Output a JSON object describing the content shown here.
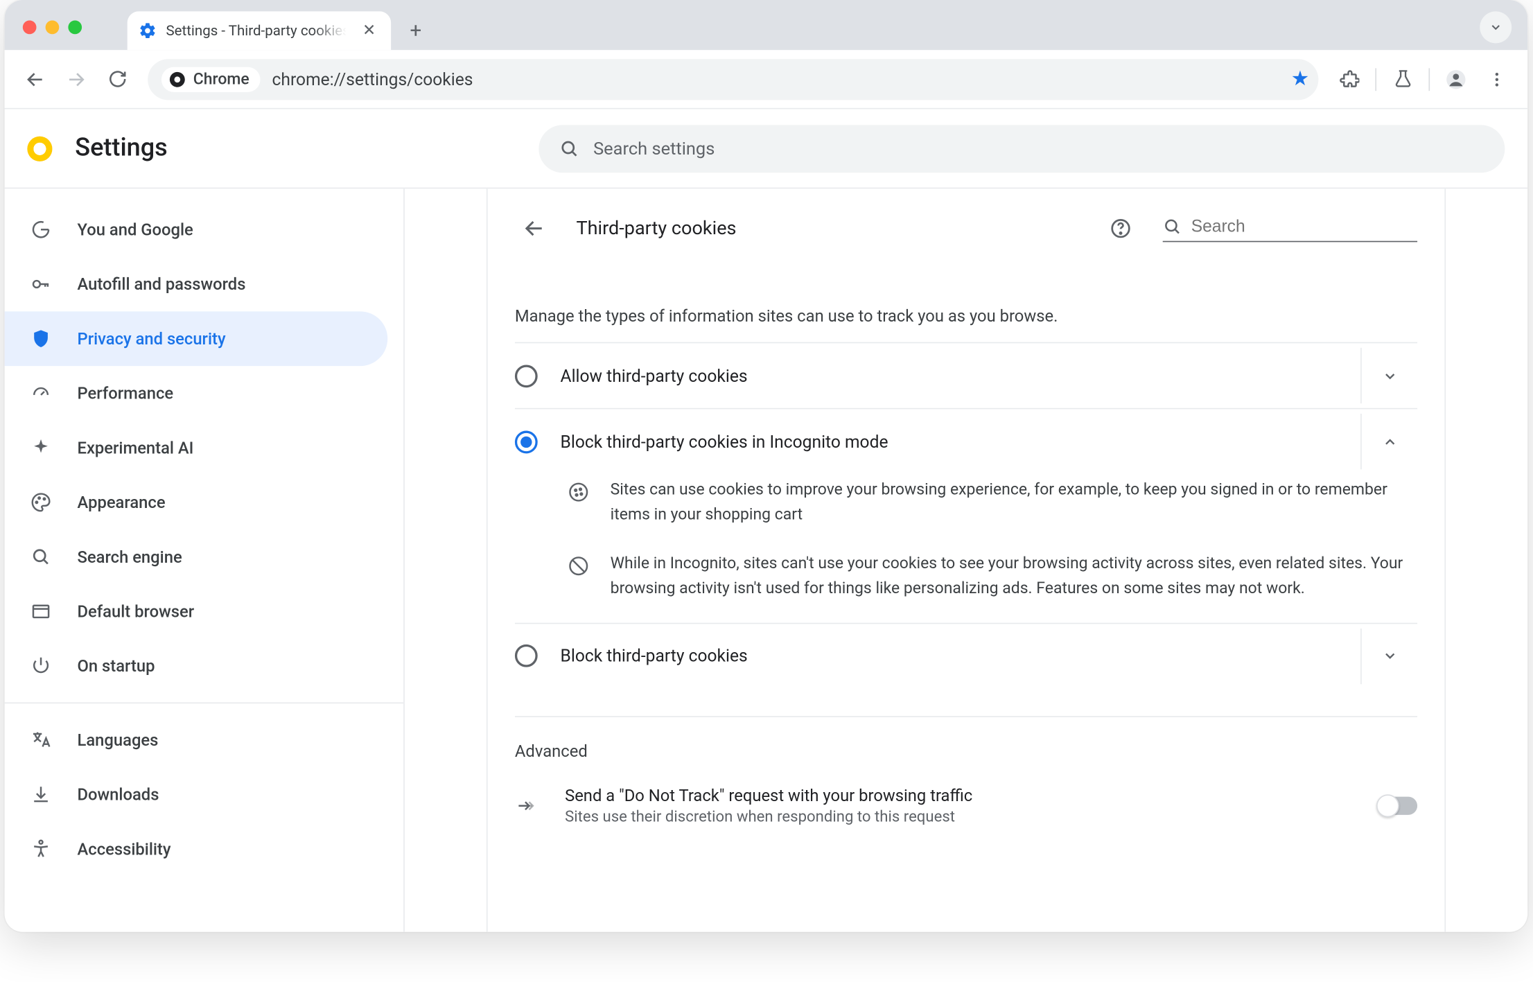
{
  "window": {
    "tab_title": "Settings - Third-party cookies",
    "omnibox_provider": "Chrome",
    "omnibox_url": "chrome://settings/cookies"
  },
  "header": {
    "app_title": "Settings",
    "search_placeholder": "Search settings"
  },
  "sidebar": {
    "items": [
      {
        "label": "You and Google"
      },
      {
        "label": "Autofill and passwords"
      },
      {
        "label": "Privacy and security"
      },
      {
        "label": "Performance"
      },
      {
        "label": "Experimental AI"
      },
      {
        "label": "Appearance"
      },
      {
        "label": "Search engine"
      },
      {
        "label": "Default browser"
      },
      {
        "label": "On startup"
      }
    ],
    "items2": [
      {
        "label": "Languages"
      },
      {
        "label": "Downloads"
      },
      {
        "label": "Accessibility"
      }
    ]
  },
  "panel": {
    "title": "Third-party cookies",
    "search_placeholder": "Search",
    "intro": "Manage the types of information sites can use to track you as you browse.",
    "options": [
      {
        "label": "Allow third-party cookies"
      },
      {
        "label": "Block third-party cookies in Incognito mode"
      },
      {
        "label": "Block third-party cookies"
      }
    ],
    "detail1": "Sites can use cookies to improve your browsing experience, for example, to keep you signed in or to remember items in your shopping cart",
    "detail2": "While in Incognito, sites can't use your cookies to see your browsing activity across sites, even related sites. Your browsing activity isn't used for things like personalizing ads. Features on some sites may not work.",
    "advanced_label": "Advanced",
    "dnt": {
      "title": "Send a \"Do Not Track\" request with your browsing traffic",
      "sub": "Sites use their discretion when responding to this request"
    }
  }
}
